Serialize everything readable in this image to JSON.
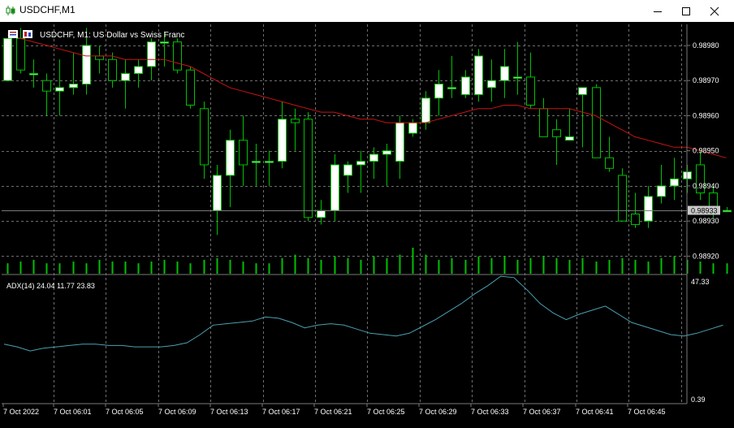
{
  "window": {
    "title": "USDCHF,M1",
    "icon": "candlestick-chart-icon",
    "controls": [
      "minimize-icon",
      "maximize-icon",
      "close-icon"
    ]
  },
  "chart_header": {
    "symbol_text": "USDCHF, M1:  US Dollar vs Swiss Franc"
  },
  "price_axis": {
    "labels": [
      "0.98980",
      "0.98970",
      "0.98960",
      "0.98950",
      "0.98940",
      "0.98930",
      "0.98920"
    ],
    "current_price": "0.98933"
  },
  "indicator": {
    "label": "ADX(14) 24.04 11.77 23.83",
    "axis_top": "47.33",
    "axis_bottom": "0.39"
  },
  "time_axis": {
    "labels": [
      "7 Oct 2022",
      "7 Oct 06:01",
      "7 Oct 06:05",
      "7 Oct 06:09",
      "7 Oct 06:13",
      "7 Oct 06:17",
      "7 Oct 06:21",
      "7 Oct 06:25",
      "7 Oct 06:29",
      "7 Oct 06:33",
      "7 Oct 06:37",
      "7 Oct 06:41",
      "7 Oct 06:45"
    ]
  },
  "colors": {
    "background": "#000000",
    "grid": "#6e6e6e",
    "bull_candle": "#ffffff",
    "bear_candle": "#000000",
    "wick": "#00c000",
    "volume": "#00c000",
    "moving_average": "#c81414",
    "adx_line": "#4aa0b0",
    "axis_text": "#ffffff"
  },
  "chart_data": {
    "type": "candlestick",
    "price_range": [
      0.98915,
      0.98986
    ],
    "candles": [
      {
        "o": 0.9897,
        "h": 0.98982,
        "l": 0.9897,
        "c": 0.98982
      },
      {
        "o": 0.98982,
        "h": 0.98985,
        "l": 0.98972,
        "c": 0.98973
      },
      {
        "o": 0.98972,
        "h": 0.98976,
        "l": 0.98968,
        "c": 0.98972
      },
      {
        "o": 0.9897,
        "h": 0.98972,
        "l": 0.9896,
        "c": 0.98967
      },
      {
        "o": 0.98967,
        "h": 0.98976,
        "l": 0.9896,
        "c": 0.98968
      },
      {
        "o": 0.98968,
        "h": 0.98978,
        "l": 0.98966,
        "c": 0.98969
      },
      {
        "o": 0.98969,
        "h": 0.98985,
        "l": 0.98966,
        "c": 0.9898
      },
      {
        "o": 0.98977,
        "h": 0.9898,
        "l": 0.98972,
        "c": 0.98976
      },
      {
        "o": 0.98976,
        "h": 0.98978,
        "l": 0.98968,
        "c": 0.9897
      },
      {
        "o": 0.9897,
        "h": 0.98976,
        "l": 0.98962,
        "c": 0.98972
      },
      {
        "o": 0.98972,
        "h": 0.98976,
        "l": 0.98968,
        "c": 0.98974
      },
      {
        "o": 0.98974,
        "h": 0.98982,
        "l": 0.9897,
        "c": 0.98981
      },
      {
        "o": 0.98981,
        "h": 0.98984,
        "l": 0.98974,
        "c": 0.98981
      },
      {
        "o": 0.98981,
        "h": 0.98982,
        "l": 0.98972,
        "c": 0.98973
      },
      {
        "o": 0.98973,
        "h": 0.98974,
        "l": 0.98962,
        "c": 0.98963
      },
      {
        "o": 0.98962,
        "h": 0.98964,
        "l": 0.98942,
        "c": 0.98946
      },
      {
        "o": 0.98933,
        "h": 0.98946,
        "l": 0.98926,
        "c": 0.98943
      },
      {
        "o": 0.98943,
        "h": 0.98956,
        "l": 0.98934,
        "c": 0.98953
      },
      {
        "o": 0.98953,
        "h": 0.9896,
        "l": 0.9894,
        "c": 0.98946
      },
      {
        "o": 0.98947,
        "h": 0.98952,
        "l": 0.9894,
        "c": 0.98947
      },
      {
        "o": 0.98947,
        "h": 0.9895,
        "l": 0.9894,
        "c": 0.98947
      },
      {
        "o": 0.98947,
        "h": 0.98964,
        "l": 0.98945,
        "c": 0.98959
      },
      {
        "o": 0.98959,
        "h": 0.98962,
        "l": 0.9895,
        "c": 0.98958
      },
      {
        "o": 0.98959,
        "h": 0.98961,
        "l": 0.9893,
        "c": 0.98931
      },
      {
        "o": 0.98931,
        "h": 0.98936,
        "l": 0.98929,
        "c": 0.98933
      },
      {
        "o": 0.98933,
        "h": 0.98949,
        "l": 0.9893,
        "c": 0.98946
      },
      {
        "o": 0.98943,
        "h": 0.98947,
        "l": 0.98938,
        "c": 0.98946
      },
      {
        "o": 0.98946,
        "h": 0.9895,
        "l": 0.98938,
        "c": 0.98947
      },
      {
        "o": 0.98947,
        "h": 0.98951,
        "l": 0.98942,
        "c": 0.98949
      },
      {
        "o": 0.98949,
        "h": 0.98952,
        "l": 0.9894,
        "c": 0.9895
      },
      {
        "o": 0.98947,
        "h": 0.9896,
        "l": 0.98942,
        "c": 0.98958
      },
      {
        "o": 0.98955,
        "h": 0.98959,
        "l": 0.98954,
        "c": 0.98958
      },
      {
        "o": 0.98958,
        "h": 0.98967,
        "l": 0.98956,
        "c": 0.98965
      },
      {
        "o": 0.98965,
        "h": 0.98973,
        "l": 0.9896,
        "c": 0.98969
      },
      {
        "o": 0.98968,
        "h": 0.98977,
        "l": 0.98965,
        "c": 0.98968
      },
      {
        "o": 0.98966,
        "h": 0.98973,
        "l": 0.98965,
        "c": 0.98971
      },
      {
        "o": 0.98966,
        "h": 0.98979,
        "l": 0.98964,
        "c": 0.98977
      },
      {
        "o": 0.98968,
        "h": 0.98976,
        "l": 0.98964,
        "c": 0.9897
      },
      {
        "o": 0.9897,
        "h": 0.98979,
        "l": 0.98965,
        "c": 0.98974
      },
      {
        "o": 0.98971,
        "h": 0.98981,
        "l": 0.98966,
        "c": 0.98971
      },
      {
        "o": 0.98971,
        "h": 0.98978,
        "l": 0.98962,
        "c": 0.98963
      },
      {
        "o": 0.98962,
        "h": 0.98965,
        "l": 0.98954,
        "c": 0.98954
      },
      {
        "o": 0.98956,
        "h": 0.98959,
        "l": 0.98946,
        "c": 0.98954
      },
      {
        "o": 0.98953,
        "h": 0.98962,
        "l": 0.98953,
        "c": 0.98954
      },
      {
        "o": 0.98966,
        "h": 0.98968,
        "l": 0.98951,
        "c": 0.98968
      },
      {
        "o": 0.98968,
        "h": 0.98969,
        "l": 0.98948,
        "c": 0.98948
      },
      {
        "o": 0.98948,
        "h": 0.98954,
        "l": 0.98944,
        "c": 0.98945
      },
      {
        "o": 0.98943,
        "h": 0.98945,
        "l": 0.9893,
        "c": 0.9893
      },
      {
        "o": 0.98932,
        "h": 0.98938,
        "l": 0.98928,
        "c": 0.98929
      },
      {
        "o": 0.9893,
        "h": 0.9894,
        "l": 0.98928,
        "c": 0.98937
      },
      {
        "o": 0.98937,
        "h": 0.98946,
        "l": 0.98935,
        "c": 0.9894
      },
      {
        "o": 0.9894,
        "h": 0.98948,
        "l": 0.98936,
        "c": 0.98942
      },
      {
        "o": 0.98942,
        "h": 0.98946,
        "l": 0.98938,
        "c": 0.98944
      },
      {
        "o": 0.98946,
        "h": 0.9895,
        "l": 0.98936,
        "c": 0.98938
      },
      {
        "o": 0.98938,
        "h": 0.9894,
        "l": 0.98931,
        "c": 0.98934
      },
      {
        "o": 0.98933,
        "h": 0.98934,
        "l": 0.98933,
        "c": 0.98933
      }
    ],
    "moving_average": [
      0.98983,
      0.98982,
      0.98981,
      0.9898,
      0.98979,
      0.98978,
      0.98977,
      0.98977,
      0.98977,
      0.98976,
      0.98976,
      0.98976,
      0.98976,
      0.98975,
      0.98974,
      0.98972,
      0.9897,
      0.98968,
      0.98967,
      0.98966,
      0.98965,
      0.98964,
      0.98963,
      0.98962,
      0.98961,
      0.98961,
      0.9896,
      0.98959,
      0.98959,
      0.98958,
      0.98958,
      0.98958,
      0.98958,
      0.98959,
      0.9896,
      0.98961,
      0.98962,
      0.98962,
      0.98963,
      0.98963,
      0.98962,
      0.98962,
      0.98962,
      0.98962,
      0.98961,
      0.9896,
      0.98958,
      0.98956,
      0.98954,
      0.98953,
      0.98952,
      0.98951,
      0.98951,
      0.9895,
      0.98949,
      0.98948
    ],
    "volume": [
      6,
      7,
      8,
      6,
      6,
      7,
      6,
      8,
      7,
      7,
      6,
      7,
      8,
      7,
      6,
      8,
      9,
      8,
      7,
      6,
      6,
      9,
      11,
      9,
      8,
      10,
      9,
      8,
      10,
      9,
      11,
      15,
      11,
      8,
      9,
      8,
      10,
      9,
      10,
      8,
      9,
      10,
      9,
      8,
      9,
      7,
      8,
      9,
      8,
      7,
      9,
      10,
      8,
      7,
      6,
      6
    ],
    "adx": [
      22,
      21,
      19.5,
      20.5,
      21,
      21.5,
      22,
      22,
      21.5,
      21.5,
      21,
      21,
      21,
      21.5,
      22.5,
      25.5,
      29,
      29.5,
      30,
      30.5,
      32,
      31.5,
      30,
      28,
      29,
      29.5,
      29,
      27.5,
      26,
      25.5,
      25,
      26,
      28.5,
      31,
      34,
      37,
      40.5,
      43.5,
      47,
      46.5,
      42,
      37,
      33.5,
      31,
      33,
      34.5,
      36,
      33,
      30,
      28.5,
      27,
      25.5,
      25,
      26,
      27.5,
      29
    ],
    "adx_range": [
      0.39,
      47.33
    ]
  }
}
